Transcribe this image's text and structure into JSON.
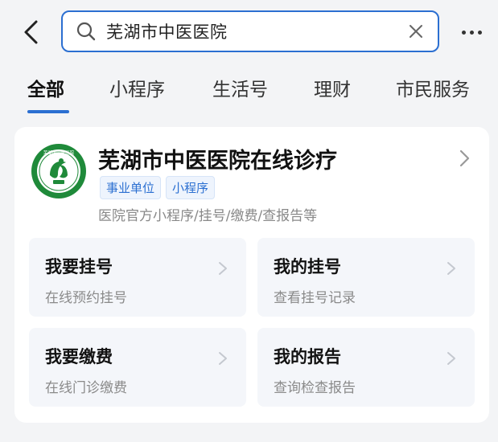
{
  "search": {
    "value": "芜湖市中医医院"
  },
  "tabs": [
    {
      "label": "全部",
      "active": true
    },
    {
      "label": "小程序",
      "active": false
    },
    {
      "label": "生活号",
      "active": false
    },
    {
      "label": "理财",
      "active": false
    },
    {
      "label": "市民服务",
      "active": false
    }
  ],
  "result": {
    "title": "芜湖市中医医院在线诊疗",
    "tags": [
      "事业单位",
      "小程序"
    ],
    "description": "医院官方小程序/挂号/缴费/查报告等",
    "logo_text": "芜湖市中医医院",
    "logo_color": "#1f8a3a",
    "services": [
      {
        "title": "我要挂号",
        "subtitle": "在线预约挂号"
      },
      {
        "title": "我的挂号",
        "subtitle": "查看挂号记录"
      },
      {
        "title": "我要缴费",
        "subtitle": "在线门诊缴费"
      },
      {
        "title": "我的报告",
        "subtitle": "查询检查报告"
      }
    ]
  },
  "colors": {
    "accent": "#2b6fd1",
    "background": "#f3f4f6",
    "card": "#ffffff",
    "tile": "#f4f6fa"
  },
  "icons": {
    "back": "back-arrow-icon",
    "search": "search-icon",
    "clear": "close-icon",
    "more": "more-dots-icon",
    "chevron": "chevron-right-icon"
  }
}
